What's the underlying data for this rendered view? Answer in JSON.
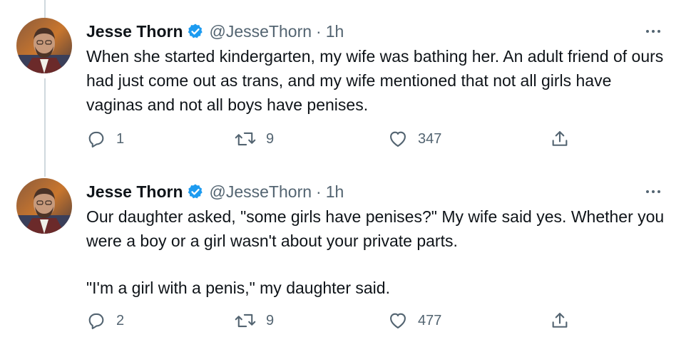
{
  "tweets": [
    {
      "author_name": "Jesse Thorn",
      "handle": "@JesseThorn",
      "separator": "·",
      "time": "1h",
      "paragraphs": [
        "When she started kindergarten, my wife was bathing her. An adult friend of ours had just come out as trans, and my wife mentioned that not all girls have vaginas and not all boys have penises."
      ],
      "replies": "1",
      "retweets": "9",
      "likes": "347"
    },
    {
      "author_name": "Jesse Thorn",
      "handle": "@JesseThorn",
      "separator": "·",
      "time": "1h",
      "paragraphs": [
        "Our daughter asked, \"some girls have penises?\" My wife said yes. Whether you were a boy or a girl wasn't about your private parts.",
        "\"I'm a girl with a penis,\" my daughter said."
      ],
      "replies": "2",
      "retweets": "9",
      "likes": "477"
    }
  ],
  "icons": {
    "verified": "verified-badge-icon",
    "more": "more-options-icon",
    "reply": "reply-icon",
    "retweet": "retweet-icon",
    "like": "like-icon",
    "share": "share-icon"
  },
  "colors": {
    "verified": "#1d9bf0",
    "secondary_text": "#536471",
    "thread_line": "#cfd9de"
  }
}
